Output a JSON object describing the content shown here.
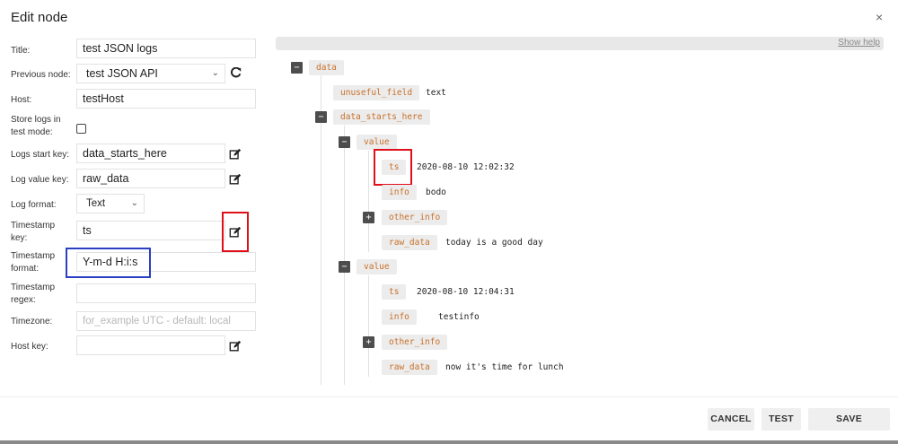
{
  "dialog": {
    "title": "Edit node",
    "close_label": "×"
  },
  "form": {
    "title_label": "Title:",
    "title_value": "test JSON logs",
    "previous_label": "Previous node:",
    "previous_value": "test JSON API",
    "host_label": "Host:",
    "host_value": "testHost",
    "store_logs_label": "Store logs in test mode:",
    "store_logs_checked": false,
    "logs_start_label": "Logs start key:",
    "logs_start_value": "data_starts_here",
    "log_value_label": "Log value key:",
    "log_value_value": "raw_data",
    "log_format_label": "Log format:",
    "log_format_value": "Text",
    "timestamp_key_label": "Timestamp key:",
    "timestamp_key_value": "ts",
    "timestamp_format_label": "Timestamp format:",
    "timestamp_format_value": "Y-m-d H:i:s",
    "timestamp_regex_label": "Timestamp regex:",
    "timestamp_regex_value": "",
    "timezone_label": "Timezone:",
    "timezone_placeholder": "for_example UTC - default: local",
    "host_key_label": "Host key:",
    "host_key_value": ""
  },
  "tree": {
    "show_help": "Show help",
    "nodes": {
      "root": "data",
      "unuseful_key": "unuseful_field",
      "unuseful_val": "text",
      "starts_key": "data_starts_here",
      "value1": "value",
      "ts1_key": "ts",
      "ts1_val": "2020-08-10 12:02:32",
      "info1_key": "info",
      "info1_val": "bodo",
      "other1_key": "other_info",
      "raw1_key": "raw_data",
      "raw1_val": "today is a good day",
      "value2": "value",
      "ts2_key": "ts",
      "ts2_val": "2020-08-10 12:04:31",
      "info2_key": "info",
      "info2_val": "testinfo",
      "other2_key": "other_info",
      "raw2_key": "raw_data",
      "raw2_val": "now it's time for lunch"
    },
    "toggle_collapse": "−",
    "toggle_expand": "+"
  },
  "footer": {
    "cancel": "CANCEL",
    "test": "TEST",
    "save": "SAVE"
  },
  "colors": {
    "key_text": "#c8702a",
    "highlight_red": "#e0101a",
    "highlight_blue": "#2a3fc1"
  }
}
